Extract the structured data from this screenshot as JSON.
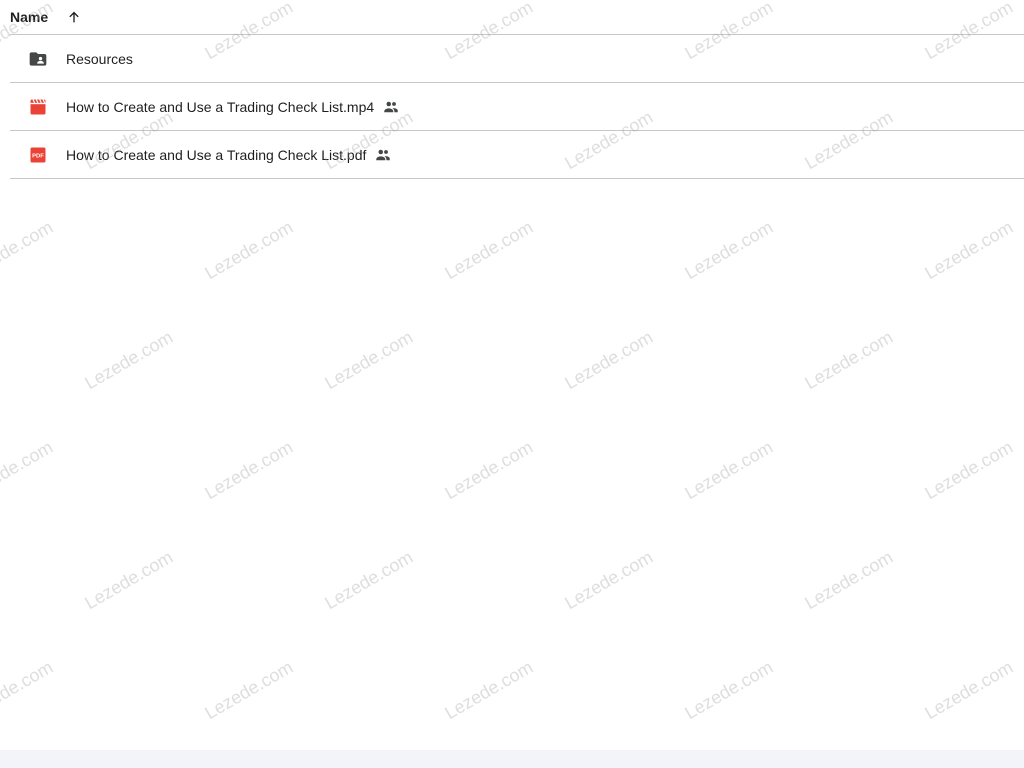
{
  "header": {
    "column_label": "Name",
    "sort_icon": "arrow-up-icon"
  },
  "files": [
    {
      "name": "Resources",
      "type": "shared-folder",
      "icon": "folder-shared-icon",
      "shared": false
    },
    {
      "name": "How to Create and Use a Trading Check List.mp4",
      "type": "video",
      "icon": "video-file-icon",
      "shared": true
    },
    {
      "name": "How to Create and Use a Trading Check List.pdf",
      "type": "pdf",
      "icon": "pdf-file-icon",
      "icon_text": "PDF",
      "shared": true
    }
  ],
  "watermark": "Lezede.com",
  "colors": {
    "folder": "#444746",
    "video": "#ea4335",
    "pdf": "#ea4335",
    "divider": "#c7c7c7"
  }
}
